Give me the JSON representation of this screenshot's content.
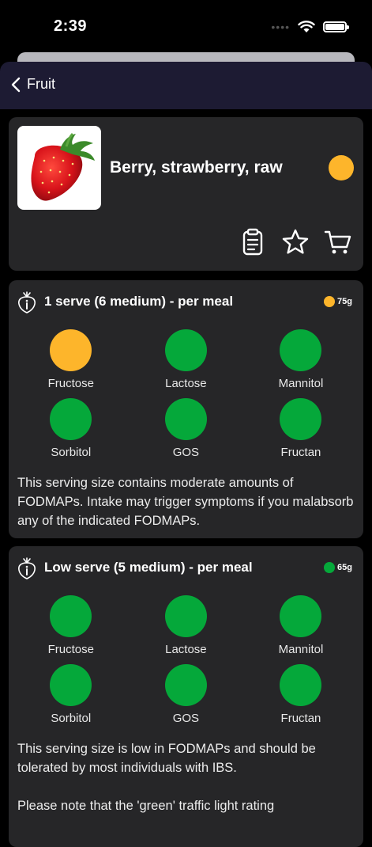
{
  "status_bar": {
    "time": "2:39"
  },
  "nav": {
    "back_label": "Fruit"
  },
  "food": {
    "name": "Berry, strawberry, raw",
    "rating_color": "#fdb52b"
  },
  "colors": {
    "green": "#05a83a",
    "amber": "#fdb52b"
  },
  "actions": [
    {
      "name": "clipboard-icon"
    },
    {
      "name": "star-icon"
    },
    {
      "name": "cart-icon"
    }
  ],
  "serves": [
    {
      "title": "1 serve (6 medium) - per meal",
      "weight": "75g",
      "rating": "amber",
      "fodmaps": [
        {
          "label": "Fructose",
          "level": "amber"
        },
        {
          "label": "Lactose",
          "level": "green"
        },
        {
          "label": "Mannitol",
          "level": "green"
        },
        {
          "label": "Sorbitol",
          "level": "green"
        },
        {
          "label": "GOS",
          "level": "green"
        },
        {
          "label": "Fructan",
          "level": "green"
        }
      ],
      "description": "This serving size contains moderate amounts of FODMAPs. Intake may trigger symptoms if you malabsorb any of the indicated FODMAPs."
    },
    {
      "title": "Low serve (5 medium) - per meal",
      "weight": "65g",
      "rating": "green",
      "fodmaps": [
        {
          "label": "Fructose",
          "level": "green"
        },
        {
          "label": "Lactose",
          "level": "green"
        },
        {
          "label": "Mannitol",
          "level": "green"
        },
        {
          "label": "Sorbitol",
          "level": "green"
        },
        {
          "label": "GOS",
          "level": "green"
        },
        {
          "label": "Fructan",
          "level": "green"
        }
      ],
      "description": "This serving size is low in FODMAPs and should be tolerated by most individuals with IBS.",
      "note": "Please note that the 'green' traffic light rating"
    }
  ]
}
